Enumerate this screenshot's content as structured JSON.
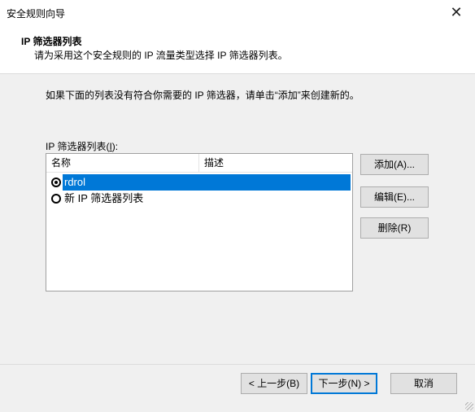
{
  "window": {
    "title": "安全规则向导",
    "close_glyph": "✕"
  },
  "header": {
    "title": "IP 筛选器列表",
    "subtitle": "请为采用这个安全规则的 IP 流量类型选择 IP 筛选器列表。"
  },
  "main": {
    "instruction": "如果下面的列表没有符合你需要的 IP 筛选器，请单击“添加”来创建新的。",
    "list_label_prefix": "IP 筛选器列表(",
    "list_label_hotkey": "I",
    "list_label_suffix": "):",
    "columns": [
      "名称",
      "描述"
    ],
    "rows": [
      {
        "name": "rdrol",
        "description": "",
        "checked": true,
        "selected": true
      },
      {
        "name": "新 IP 筛选器列表",
        "description": "",
        "checked": false,
        "selected": false
      }
    ],
    "buttons": {
      "add": "添加(A)...",
      "edit": "编辑(E)...",
      "remove": "删除(R)"
    }
  },
  "footer": {
    "back": "< 上一步(B)",
    "next": "下一步(N) >",
    "cancel": "取消"
  },
  "colors": {
    "selection": "#0078d7",
    "dialog_bg": "#f0f0f0"
  }
}
